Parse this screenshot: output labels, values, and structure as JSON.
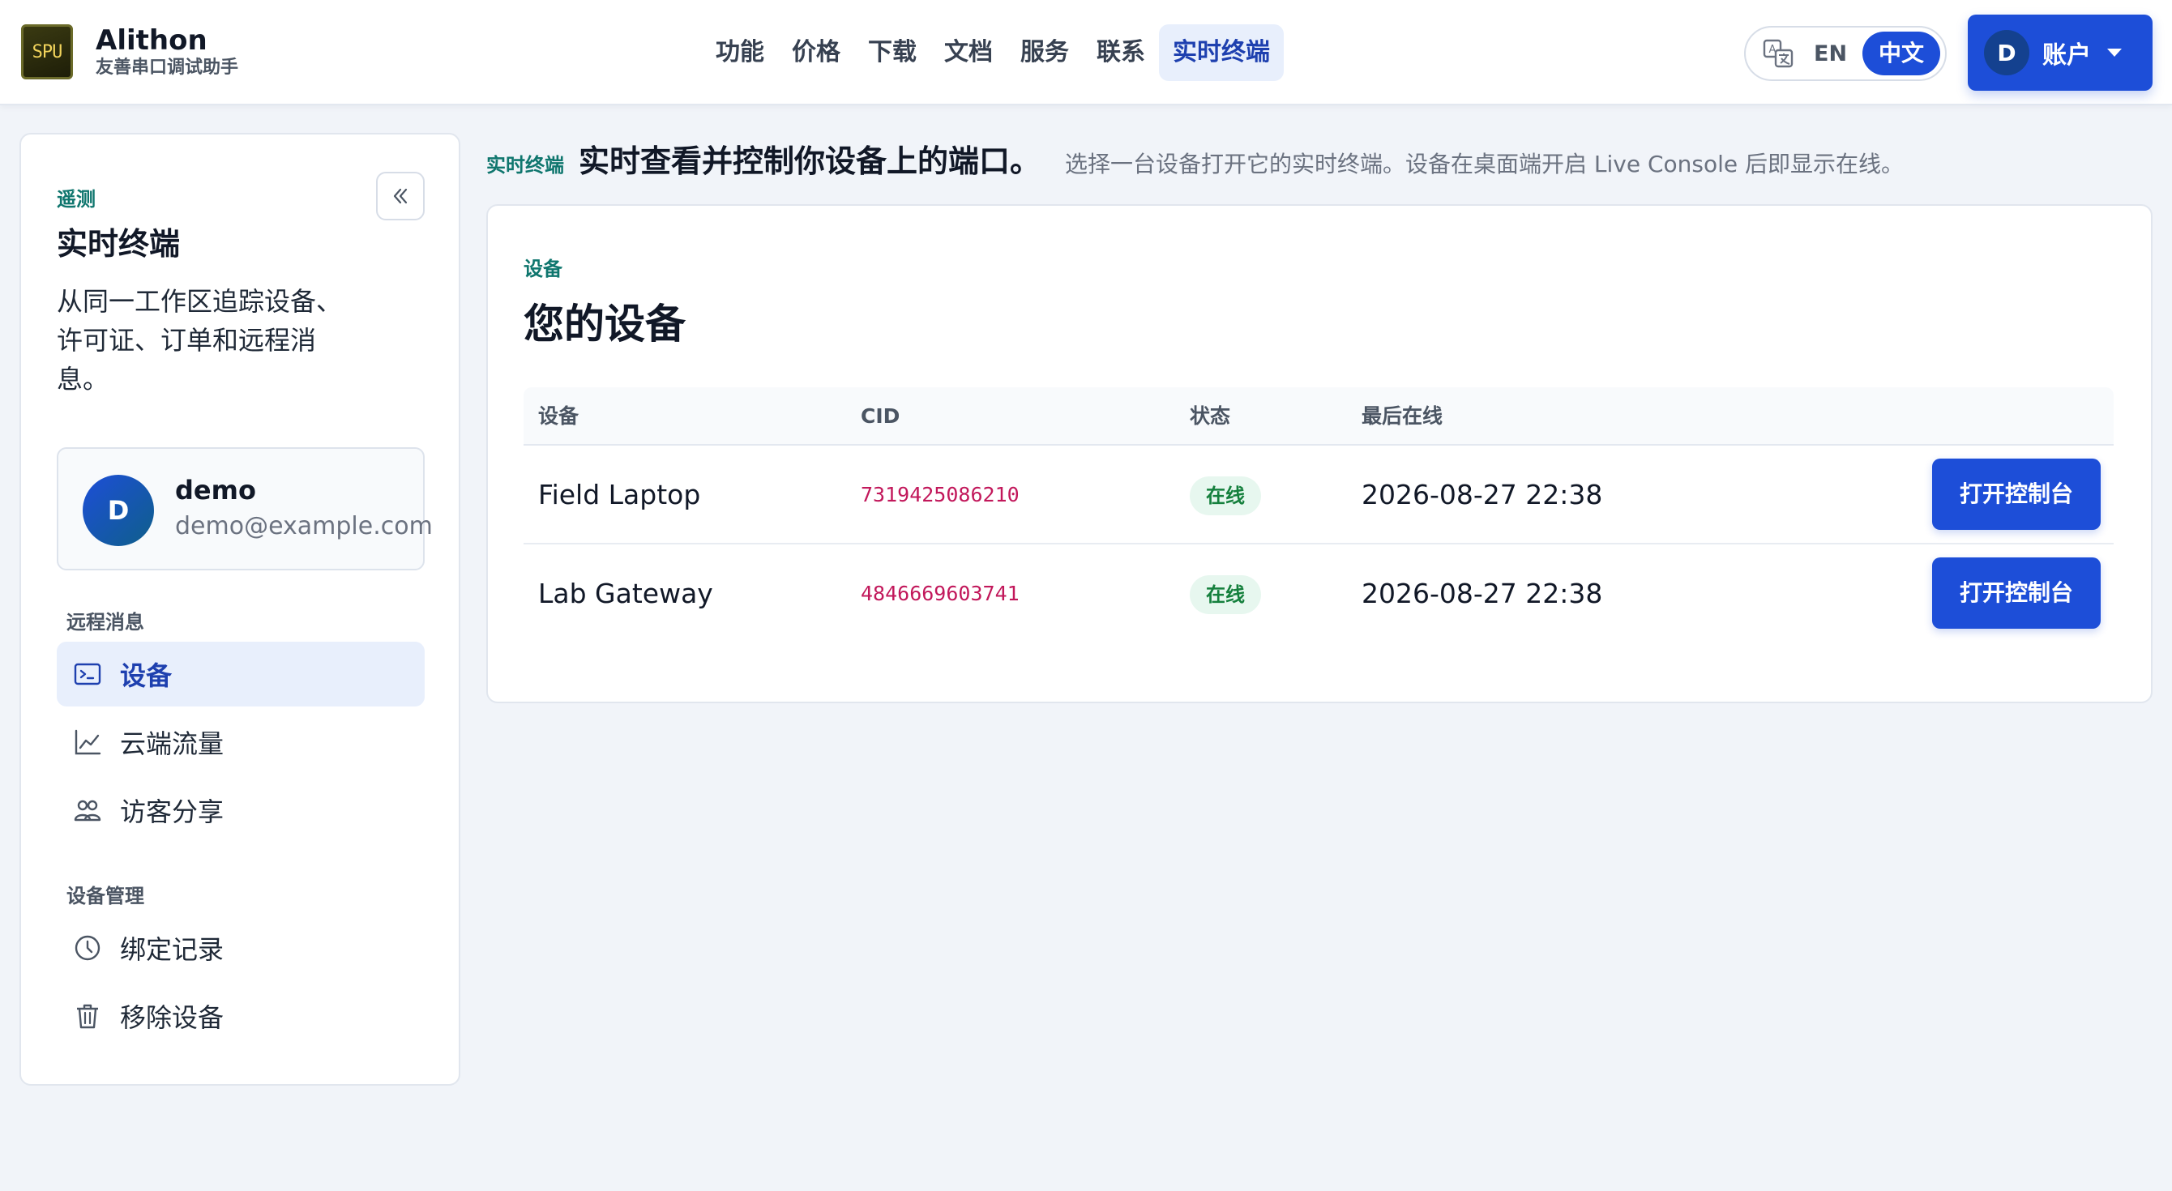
{
  "brand": {
    "logo_text": "SPU",
    "name": "Alithon",
    "subtitle": "友善串口调试助手"
  },
  "nav": {
    "items": [
      {
        "label": "功能"
      },
      {
        "label": "价格"
      },
      {
        "label": "下载"
      },
      {
        "label": "文档"
      },
      {
        "label": "服务"
      },
      {
        "label": "联系"
      },
      {
        "label": "实时终端",
        "active": true
      }
    ]
  },
  "lang": {
    "icon": "translate-icon",
    "en": "EN",
    "zh": "中文",
    "selected": "中文"
  },
  "account": {
    "initial": "D",
    "label": "账户",
    "icon": "caret-down-icon"
  },
  "sidebar": {
    "eyebrow": "遥测",
    "title": "实时终端",
    "description": "从同一工作区追踪设备、许可证、订单和远程消息。",
    "collapse_icon": "chevrons-left-icon",
    "user": {
      "initial": "D",
      "name": "demo",
      "email": "demo@example.com"
    },
    "sections": [
      {
        "title": "远程消息",
        "items": [
          {
            "label": "设备",
            "icon": "terminal-icon",
            "active": true
          },
          {
            "label": "云端流量",
            "icon": "line-chart-icon"
          },
          {
            "label": "访客分享",
            "icon": "users-icon"
          }
        ]
      },
      {
        "title": "设备管理",
        "items": [
          {
            "label": "绑定记录",
            "icon": "clock-icon"
          },
          {
            "label": "移除设备",
            "icon": "trash-icon"
          }
        ]
      }
    ]
  },
  "intro": {
    "tag": "实时终端",
    "title": "实时查看并控制你设备上的端口。",
    "description": "选择一台设备打开它的实时终端。设备在桌面端开启 Live Console 后即显示在线。"
  },
  "devices": {
    "eyebrow": "设备",
    "title": "您的设备",
    "columns": [
      "设备",
      "CID",
      "状态",
      "最后在线"
    ],
    "rows": [
      {
        "name": "Field Laptop",
        "cid": "7319425086210",
        "status": "在线",
        "last_seen": "2026-08-27 22:38",
        "action": "打开控制台"
      },
      {
        "name": "Lab Gateway",
        "cid": "4846669603741",
        "status": "在线",
        "last_seen": "2026-08-27 22:38",
        "action": "打开控制台"
      }
    ]
  },
  "colors": {
    "accent": "#1d4ed8",
    "eyebrow": "#0f766e",
    "online": "#15803d",
    "cid": "#c2185b"
  }
}
